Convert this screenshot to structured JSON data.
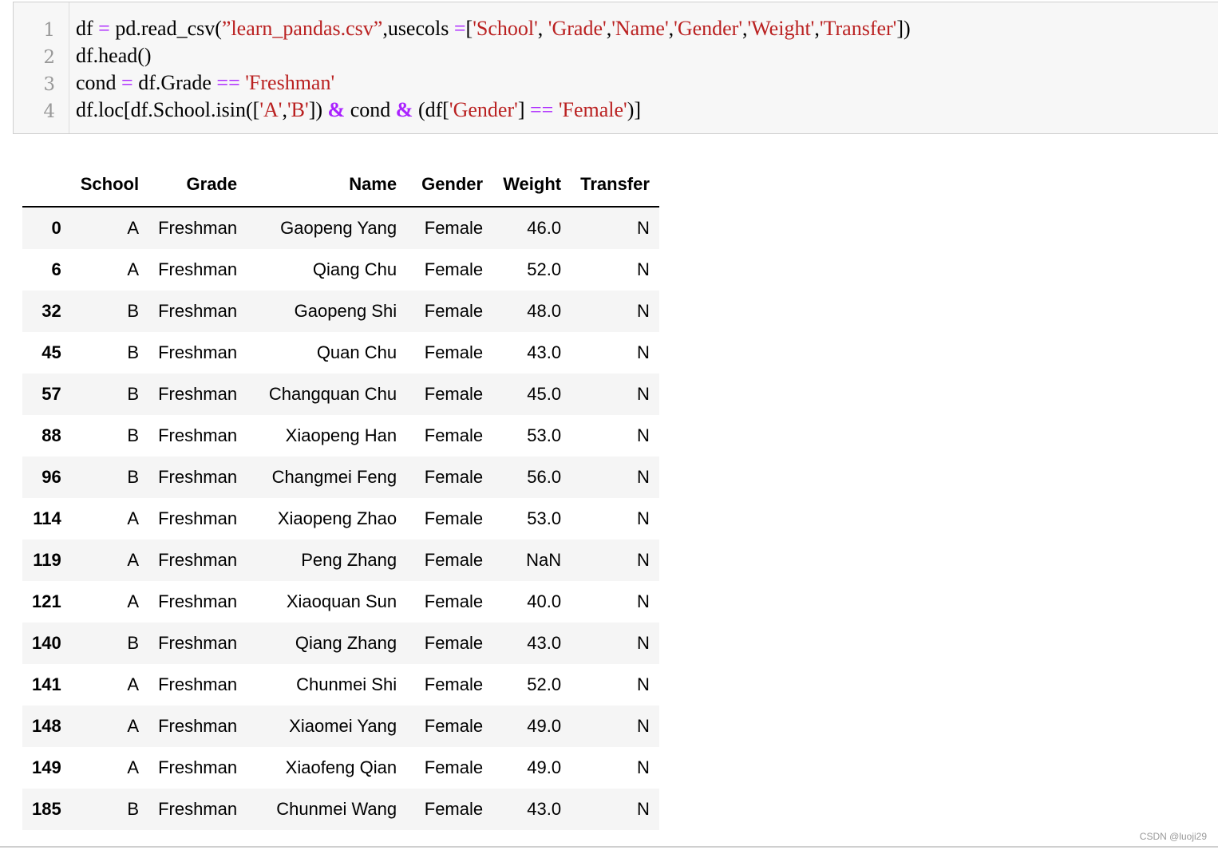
{
  "code": {
    "line_numbers": [
      "1",
      "2",
      "3",
      "4"
    ],
    "lines": [
      [
        {
          "t": "df ",
          "c": "name"
        },
        {
          "t": "=",
          "c": "eq"
        },
        {
          "t": " pd.read_csv(",
          "c": "name"
        },
        {
          "t": "”learn_pandas.csv”",
          "c": "str"
        },
        {
          "t": ",usecols ",
          "c": "name"
        },
        {
          "t": "=",
          "c": "eq"
        },
        {
          "t": "[",
          "c": "name"
        },
        {
          "t": "'School'",
          "c": "str"
        },
        {
          "t": ", ",
          "c": "name"
        },
        {
          "t": "'Grade'",
          "c": "str"
        },
        {
          "t": ",",
          "c": "name"
        },
        {
          "t": "'Name'",
          "c": "str"
        },
        {
          "t": ",",
          "c": "name"
        },
        {
          "t": "'Gender'",
          "c": "str"
        },
        {
          "t": ",",
          "c": "name"
        },
        {
          "t": "'Weight'",
          "c": "str"
        },
        {
          "t": ",",
          "c": "name"
        },
        {
          "t": "'Transfer'",
          "c": "str"
        },
        {
          "t": "])",
          "c": "name"
        }
      ],
      [
        {
          "t": "df.head()",
          "c": "name"
        }
      ],
      [
        {
          "t": "cond ",
          "c": "name"
        },
        {
          "t": "=",
          "c": "eq"
        },
        {
          "t": " df.Grade ",
          "c": "name"
        },
        {
          "t": "==",
          "c": "eq"
        },
        {
          "t": " ",
          "c": "name"
        },
        {
          "t": "'Freshman'",
          "c": "str"
        }
      ],
      [
        {
          "t": "df.loc[df.School.isin([",
          "c": "name"
        },
        {
          "t": "'A'",
          "c": "str"
        },
        {
          "t": ",",
          "c": "name"
        },
        {
          "t": "'B'",
          "c": "str"
        },
        {
          "t": "]) ",
          "c": "name"
        },
        {
          "t": "&",
          "c": "op"
        },
        {
          "t": " cond ",
          "c": "name"
        },
        {
          "t": "&",
          "c": "op"
        },
        {
          "t": " (df[",
          "c": "name"
        },
        {
          "t": "'Gender'",
          "c": "str"
        },
        {
          "t": "] ",
          "c": "name"
        },
        {
          "t": "==",
          "c": "eq"
        },
        {
          "t": " ",
          "c": "name"
        },
        {
          "t": "'Female'",
          "c": "str"
        },
        {
          "t": ")]",
          "c": "name"
        }
      ]
    ]
  },
  "table": {
    "columns": [
      "School",
      "Grade",
      "Name",
      "Gender",
      "Weight",
      "Transfer"
    ],
    "rows": [
      {
        "index": "0",
        "cells": [
          "A",
          "Freshman",
          "Gaopeng Yang",
          "Female",
          "46.0",
          "N"
        ]
      },
      {
        "index": "6",
        "cells": [
          "A",
          "Freshman",
          "Qiang Chu",
          "Female",
          "52.0",
          "N"
        ]
      },
      {
        "index": "32",
        "cells": [
          "B",
          "Freshman",
          "Gaopeng Shi",
          "Female",
          "48.0",
          "N"
        ]
      },
      {
        "index": "45",
        "cells": [
          "B",
          "Freshman",
          "Quan Chu",
          "Female",
          "43.0",
          "N"
        ]
      },
      {
        "index": "57",
        "cells": [
          "B",
          "Freshman",
          "Changquan Chu",
          "Female",
          "45.0",
          "N"
        ]
      },
      {
        "index": "88",
        "cells": [
          "B",
          "Freshman",
          "Xiaopeng Han",
          "Female",
          "53.0",
          "N"
        ]
      },
      {
        "index": "96",
        "cells": [
          "B",
          "Freshman",
          "Changmei Feng",
          "Female",
          "56.0",
          "N"
        ]
      },
      {
        "index": "114",
        "cells": [
          "A",
          "Freshman",
          "Xiaopeng Zhao",
          "Female",
          "53.0",
          "N"
        ]
      },
      {
        "index": "119",
        "cells": [
          "A",
          "Freshman",
          "Peng Zhang",
          "Female",
          "NaN",
          "N"
        ]
      },
      {
        "index": "121",
        "cells": [
          "A",
          "Freshman",
          "Xiaoquan Sun",
          "Female",
          "40.0",
          "N"
        ]
      },
      {
        "index": "140",
        "cells": [
          "B",
          "Freshman",
          "Qiang Zhang",
          "Female",
          "43.0",
          "N"
        ]
      },
      {
        "index": "141",
        "cells": [
          "A",
          "Freshman",
          "Chunmei Shi",
          "Female",
          "52.0",
          "N"
        ]
      },
      {
        "index": "148",
        "cells": [
          "A",
          "Freshman",
          "Xiaomei Yang",
          "Female",
          "49.0",
          "N"
        ]
      },
      {
        "index": "149",
        "cells": [
          "A",
          "Freshman",
          "Xiaofeng Qian",
          "Female",
          "49.0",
          "N"
        ]
      },
      {
        "index": "185",
        "cells": [
          "B",
          "Freshman",
          "Chunmei Wang",
          "Female",
          "43.0",
          "N"
        ]
      }
    ]
  },
  "watermark": "CSDN @luoji29",
  "colors": {
    "string": "#ba2121",
    "operator": "#aa22ff",
    "code_background": "#f7f7f7",
    "row_stripe": "#f5f5f5"
  }
}
